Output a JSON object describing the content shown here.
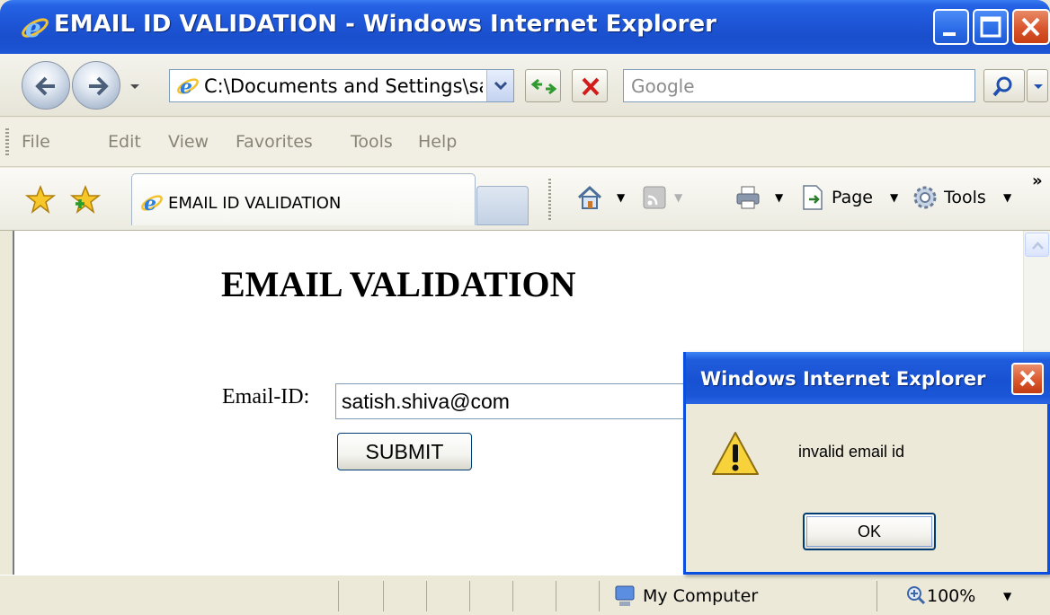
{
  "window": {
    "title": "EMAIL ID VALIDATION - Windows Internet Explorer"
  },
  "address_bar": {
    "url": "C:\\Documents and Settings\\sati:",
    "search_placeholder": "Google"
  },
  "menu": {
    "items": [
      "File",
      "Edit",
      "View",
      "Favorites",
      "Tools",
      "Help"
    ]
  },
  "tabs": {
    "active_label": "EMAIL ID VALIDATION"
  },
  "command_bar": {
    "page_label": "Page",
    "tools_label": "Tools",
    "more": "»"
  },
  "page": {
    "heading": "EMAIL VALIDATION",
    "email_label": "Email-ID:",
    "email_value": "satish.shiva@com",
    "submit_label": "SUBMIT"
  },
  "status_bar": {
    "zone": "My Computer",
    "zoom": "100%"
  },
  "dialog": {
    "title": "Windows Internet Explorer",
    "message": "invalid email id",
    "ok_label": "OK"
  },
  "colors": {
    "titlebar": "#1d55d6",
    "chrome": "#ece9d8",
    "close_button": "#d8542a"
  }
}
